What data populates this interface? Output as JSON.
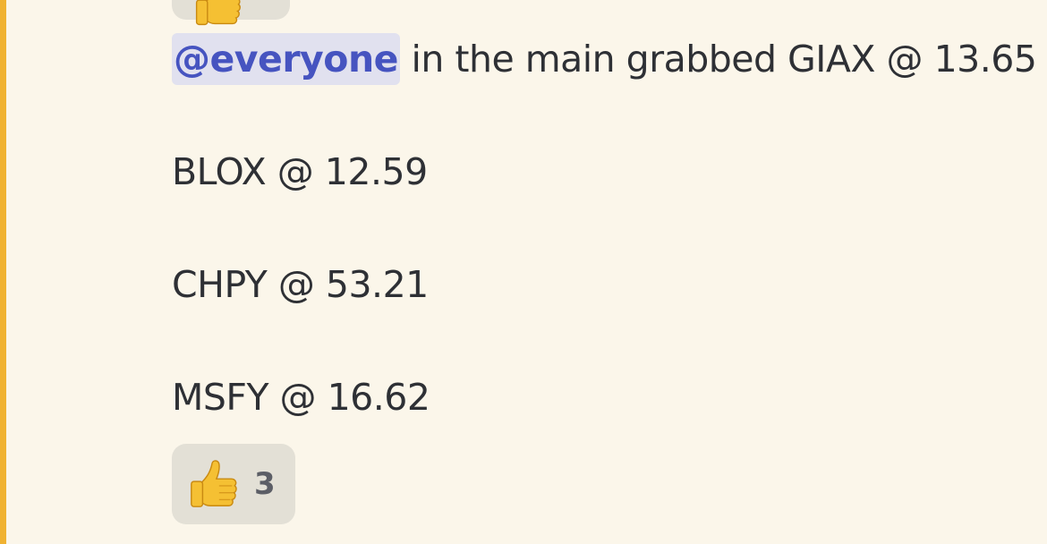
{
  "message": {
    "mention": "@everyone",
    "line_1_text": " in the main grabbed GIAX @ 13.65",
    "line_2": "BLOX @ 12.59",
    "line_3": "CHPY @ 53.21",
    "line_4": "MSFY @ 16.62"
  },
  "reactions": {
    "top": {
      "emoji": "thumbs-up-icon"
    },
    "bottom": {
      "emoji": "thumbs-up-icon",
      "count": "3"
    }
  },
  "colors": {
    "background": "#fbf6ea",
    "highlight_bar": "#f0b232",
    "mention_text": "#4654c0",
    "mention_background": "#e1e1ef",
    "reaction_background": "#e3e0d6"
  }
}
